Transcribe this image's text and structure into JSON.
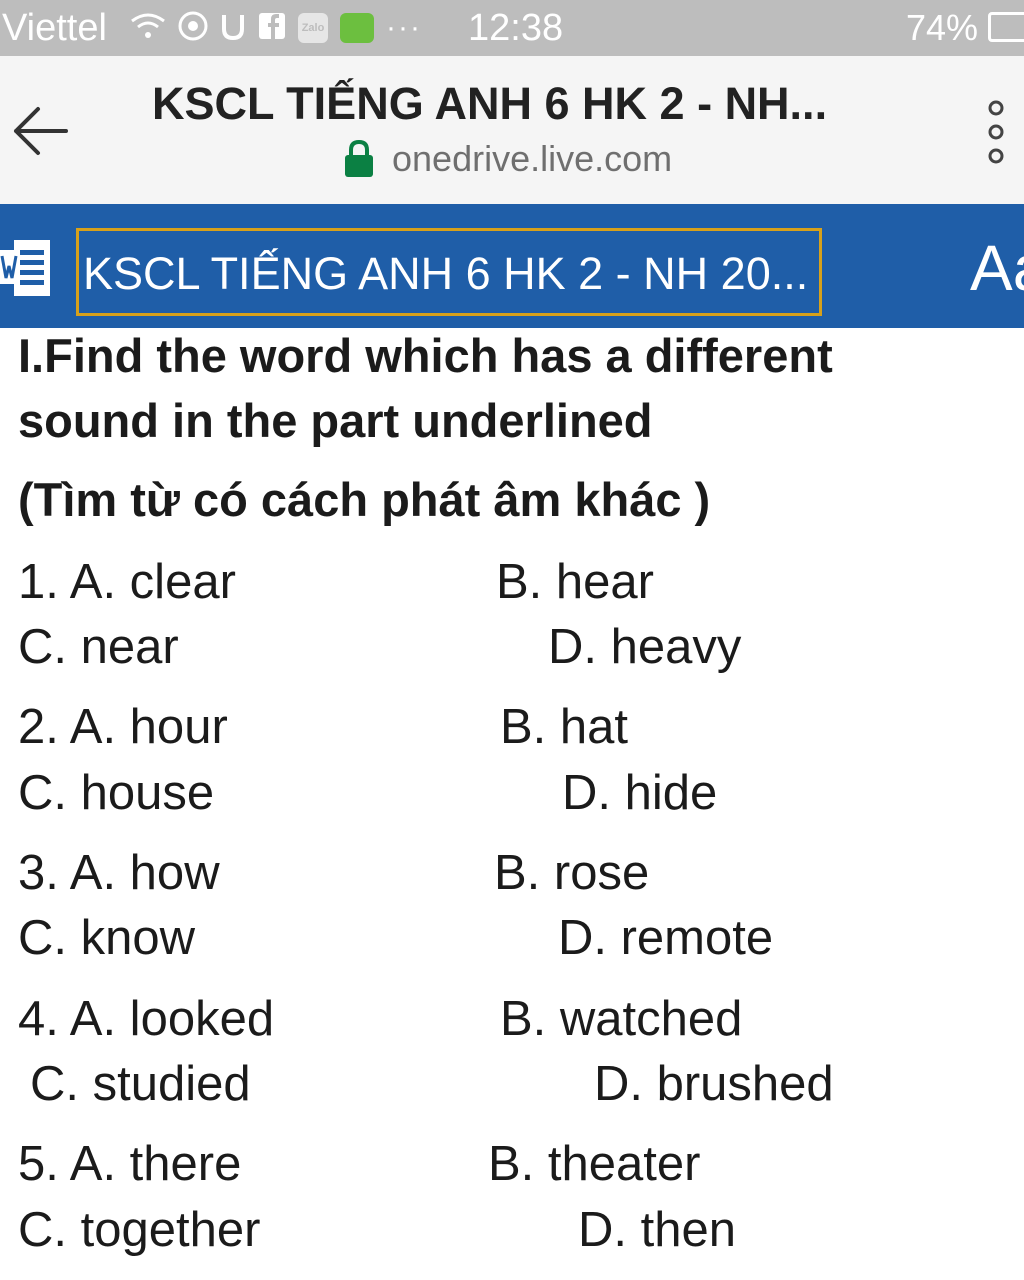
{
  "status_bar": {
    "carrier": "Viettel",
    "icons": [
      "wifi-icon",
      "chrome-icon",
      "u-icon",
      "facebook-icon",
      "zalo-icon",
      "android-icon"
    ],
    "zalo_label": "Zalo",
    "more": "···",
    "time": "12:38",
    "battery": "74%"
  },
  "browser": {
    "title": "KSCL TIẾNG ANH 6 HK 2 - NH...",
    "url": "onedrive.live.com"
  },
  "word_toolbar": {
    "doc_title": "KSCL TIẾNG ANH 6 HK 2 - NH 20...",
    "font_button": "Aa",
    "accent": "#1f5ea8",
    "outline": "#d7a11b"
  },
  "document": {
    "heading_line1": "I.Find the word which has a different",
    "heading_line2": "sound in the part underlined",
    "heading_line3": "(Tìm từ có cách phát âm khác )",
    "questions": [
      {
        "a": "1. A. clear",
        "b": "B. hear",
        "c": "C. near",
        "d": "D. heavy"
      },
      {
        "a": "2. A. hour",
        "b": "B. hat",
        "c": "C. house",
        "d": "D. hide"
      },
      {
        "a": "3. A. how",
        "b": "B. rose",
        "c": "C. know",
        "d": "D. remote"
      },
      {
        "a": "4. A. looked",
        "b": "B. watched",
        "c": "C. studied",
        "d": "D. brushed"
      },
      {
        "a": "5. A. there",
        "b": "B. theater",
        "c": "C. together",
        "d": "D. then"
      }
    ]
  }
}
